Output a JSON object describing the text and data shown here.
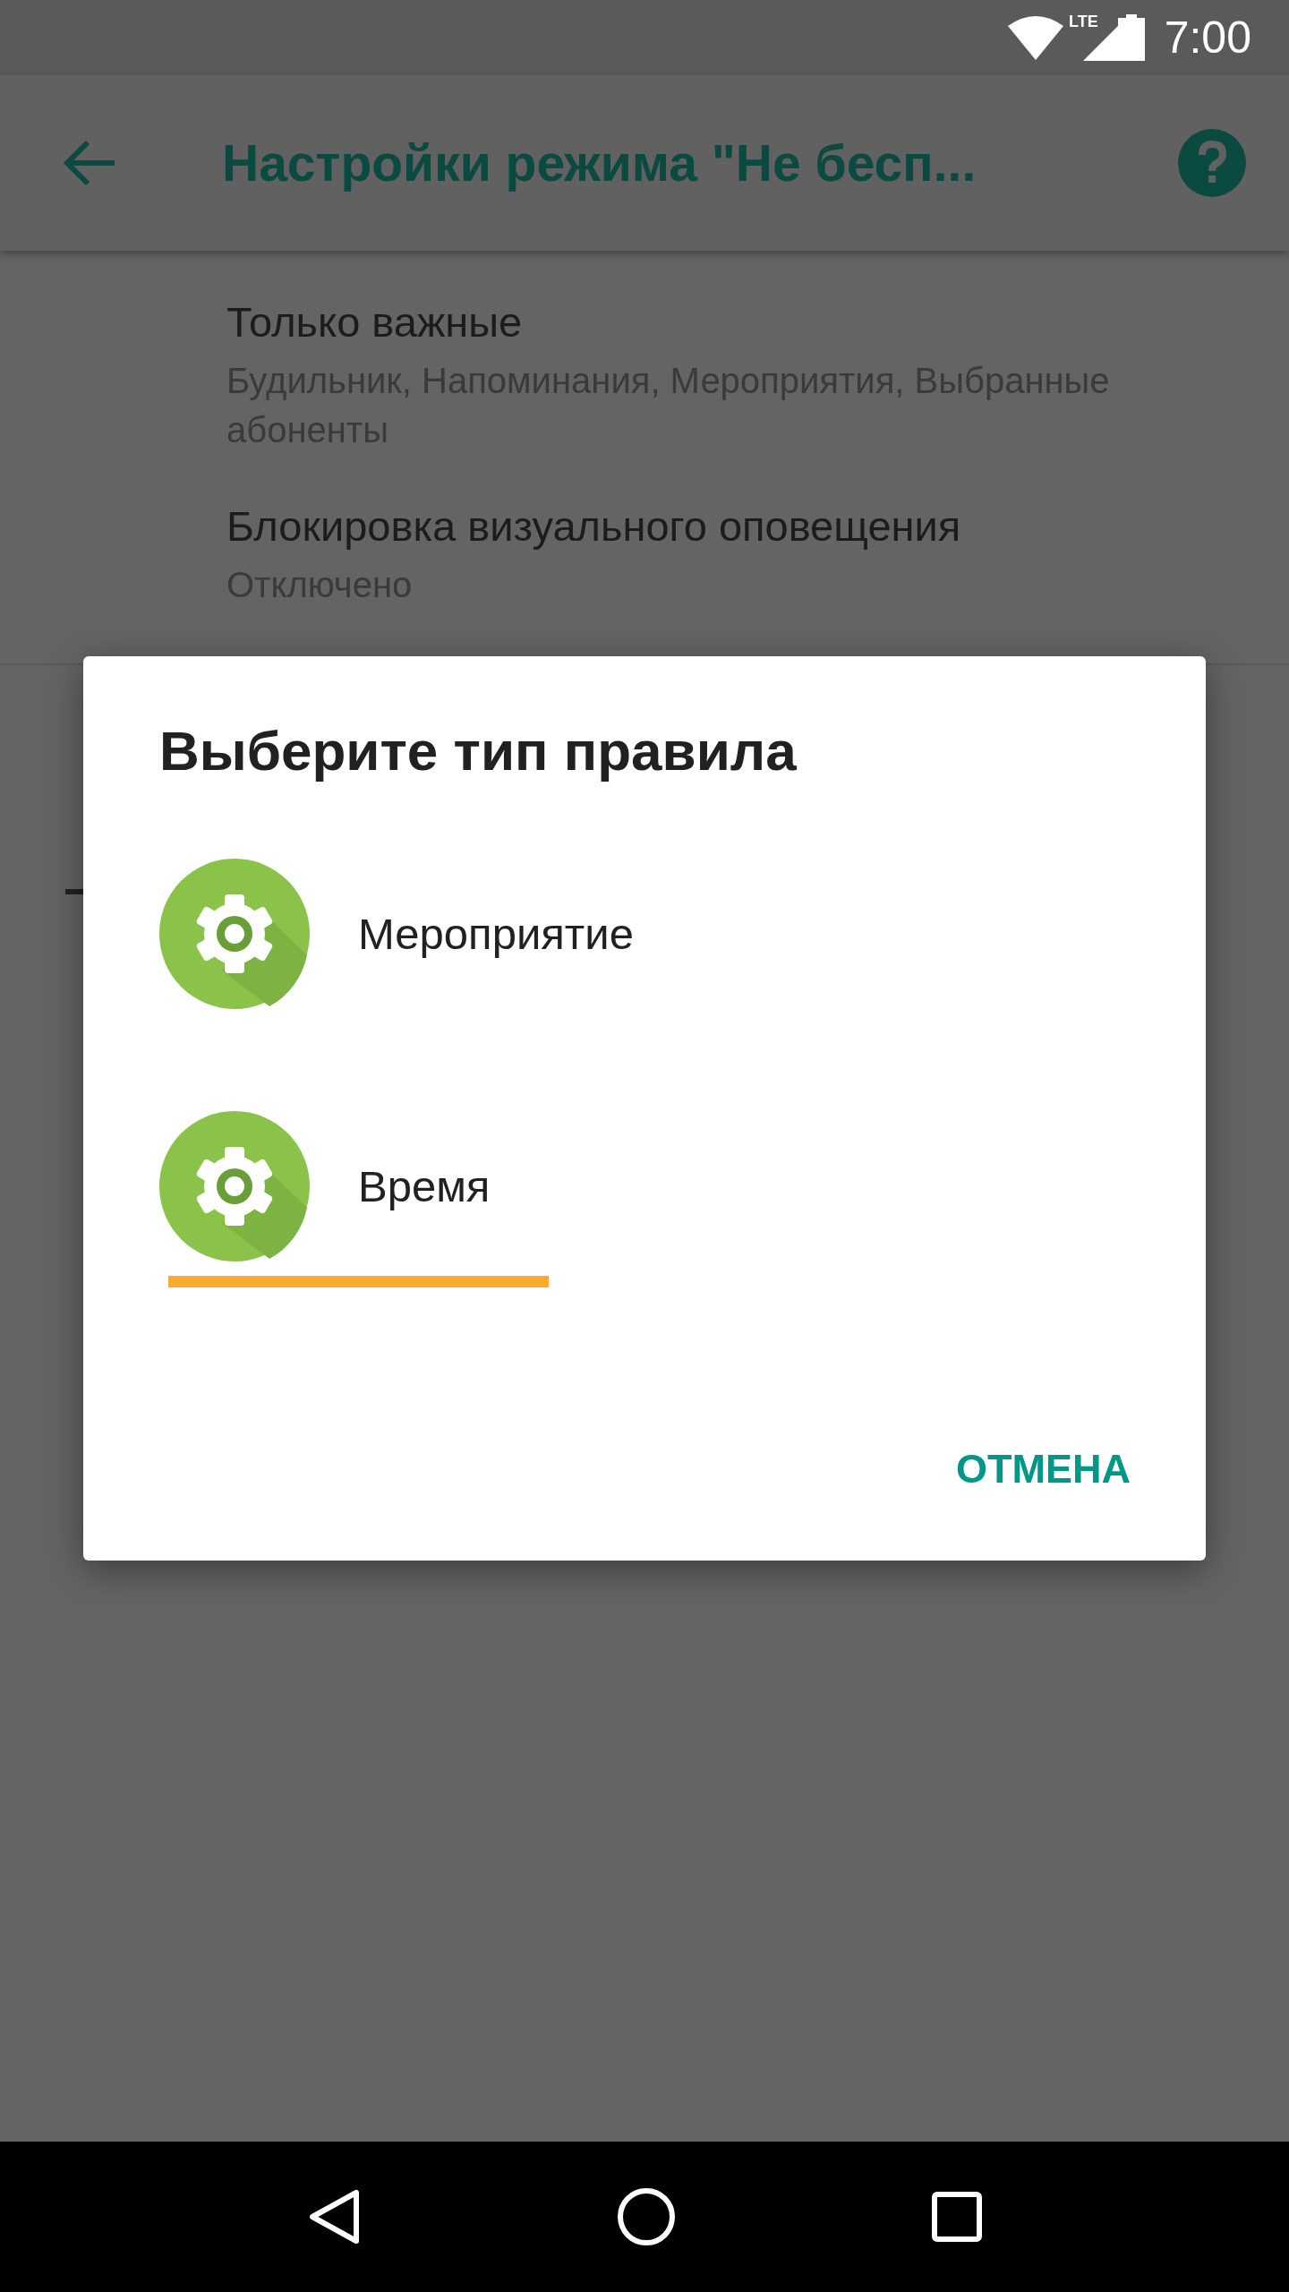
{
  "status_bar": {
    "network": "LTE",
    "time": "7:00"
  },
  "app_bar": {
    "title": "Настройки режима \"Не бесп..."
  },
  "settings": [
    {
      "title": "Только важные",
      "summary": "Будильник, Напоминания, Мероприятия, Выбранные абоненты"
    },
    {
      "title": "Блокировка визуального оповещения",
      "summary": "Отключено"
    }
  ],
  "dialog": {
    "title": "Выберите тип правила",
    "options": [
      {
        "label": "Мероприятие",
        "highlighted": false
      },
      {
        "label": "Время",
        "highlighted": true
      }
    ],
    "buttons": [
      "ОТМЕНА"
    ]
  }
}
